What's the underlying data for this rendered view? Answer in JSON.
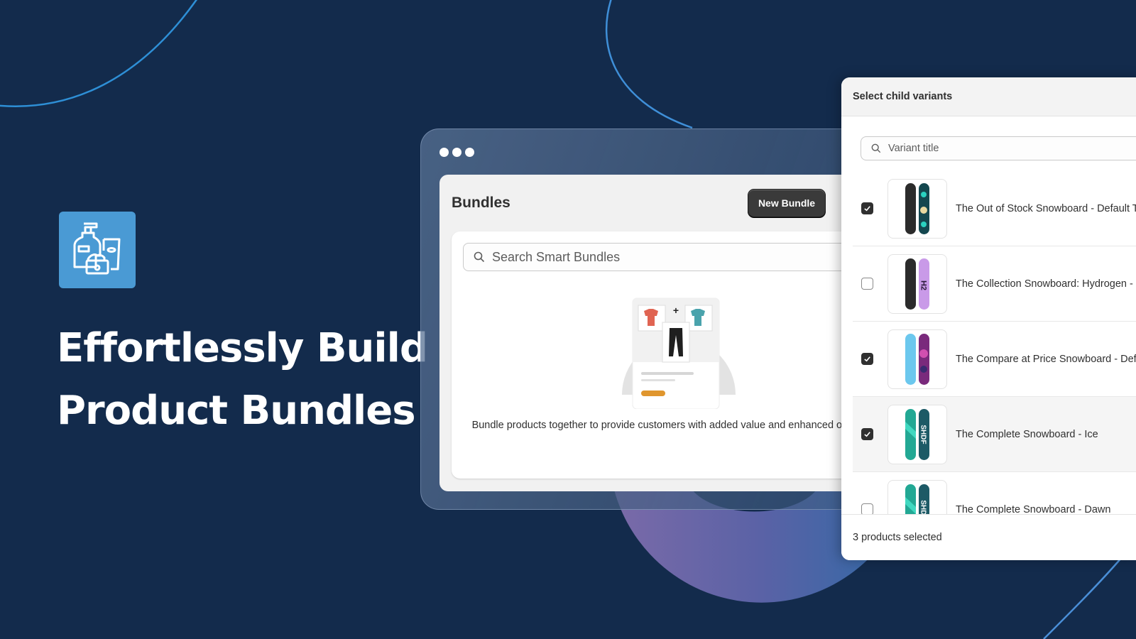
{
  "hero": {
    "title_line1": "Effortlessly Build",
    "title_line2": "Product Bundles",
    "icon": "cosmetics-bundle-icon"
  },
  "bundles_window": {
    "page_title": "Bundles",
    "new_bundle_label": "New Bundle",
    "search_placeholder": "Search Smart Bundles",
    "empty_state_text": "Bundle products together to provide customers with added value and enhanced offerings."
  },
  "variant_picker": {
    "title": "Select child variants",
    "search_placeholder": "Variant title",
    "items": [
      {
        "label": "The Out of Stock Snowboard - Default Title",
        "checked": true
      },
      {
        "label": "The Collection Snowboard: Hydrogen - Default Title",
        "checked": false
      },
      {
        "label": "The Compare at Price Snowboard - Default Title",
        "checked": true
      },
      {
        "label": "The Complete Snowboard - Ice",
        "checked": true
      },
      {
        "label": "The Complete Snowboard - Dawn",
        "checked": false
      }
    ],
    "footer": "3 products selected"
  },
  "colors": {
    "background": "#132b4c",
    "accent_line": "#3f8fd8",
    "icon_tile": "#4a9ad4",
    "button_dark": "#3a3a3a",
    "shirt_red": "#e06452",
    "shirt_teal": "#4aa3ac",
    "pill_orange": "#e0962e"
  }
}
